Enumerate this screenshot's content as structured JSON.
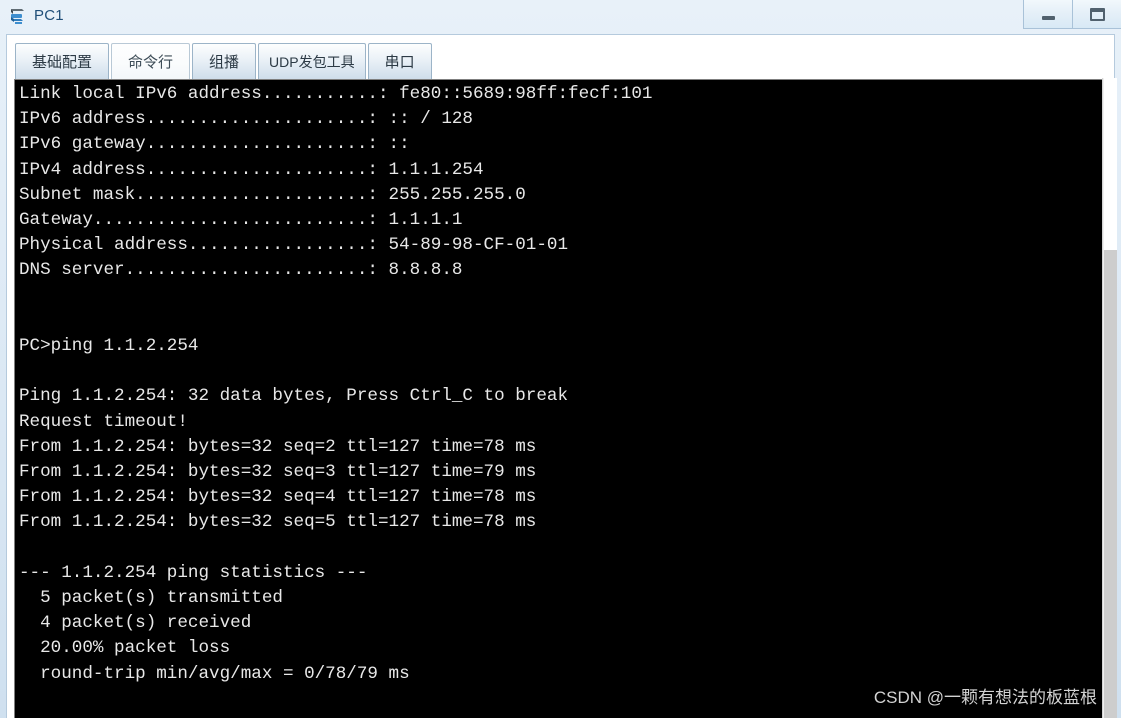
{
  "window": {
    "title": "PC1",
    "icon": "pc-device-icon",
    "controls": [
      {
        "name": "minimize-button",
        "label": "—"
      },
      {
        "name": "maximize-button",
        "label": "❐"
      }
    ]
  },
  "tabs": [
    {
      "label": "基础配置",
      "name": "tab-basic-config",
      "active": false
    },
    {
      "label": "命令行",
      "name": "tab-command-line",
      "active": true
    },
    {
      "label": "组播",
      "name": "tab-multicast",
      "active": false
    },
    {
      "label": "UDP发包工具",
      "name": "tab-udp-tool",
      "active": false
    },
    {
      "label": "串口",
      "name": "tab-serial-port",
      "active": false
    }
  ],
  "terminal": {
    "lines": [
      "Link local IPv6 address...........: fe80::5689:98ff:fecf:101",
      "IPv6 address.....................: :: / 128",
      "IPv6 gateway.....................: ::",
      "IPv4 address.....................: 1.1.1.254",
      "Subnet mask......................: 255.255.255.0",
      "Gateway..........................: 1.1.1.1",
      "Physical address.................: 54-89-98-CF-01-01",
      "DNS server.......................: 8.8.8.8",
      "",
      "",
      "PC>ping 1.1.2.254",
      "",
      "Ping 1.1.2.254: 32 data bytes, Press Ctrl_C to break",
      "Request timeout!",
      "From 1.1.2.254: bytes=32 seq=2 ttl=127 time=78 ms",
      "From 1.1.2.254: bytes=32 seq=3 ttl=127 time=79 ms",
      "From 1.1.2.254: bytes=32 seq=4 ttl=127 time=78 ms",
      "From 1.1.2.254: bytes=32 seq=5 ttl=127 time=78 ms",
      "",
      "--- 1.1.2.254 ping statistics ---",
      "  5 packet(s) transmitted",
      "  4 packet(s) received",
      "  20.00% packet loss",
      "  round-trip min/avg/max = 0/78/79 ms"
    ],
    "network_info": {
      "link_local_ipv6": "fe80::5689:98ff:fecf:101",
      "ipv6_address": ":: / 128",
      "ipv6_gateway": "::",
      "ipv4_address": "1.1.1.254",
      "subnet_mask": "255.255.255.0",
      "gateway": "1.1.1.1",
      "physical_address": "54-89-98-CF-01-01",
      "dns_server": "8.8.8.8"
    },
    "ping": {
      "command": "PC>ping 1.1.2.254",
      "target": "1.1.2.254",
      "data_bytes": "32",
      "break_hint": "Press Ctrl_C to break",
      "transmitted": "5",
      "received": "4",
      "packet_loss": "20.00%",
      "round_trip_min": "0",
      "round_trip_avg": "78",
      "round_trip_max": "79"
    },
    "colors": {
      "background": "#000000",
      "foreground": "#e8e8e8"
    }
  },
  "scrollbar": {
    "name": "terminal-scrollbar",
    "thumb_position_percent": 0
  },
  "watermark": {
    "text": "CSDN @一颗有想法的板蓝根"
  }
}
